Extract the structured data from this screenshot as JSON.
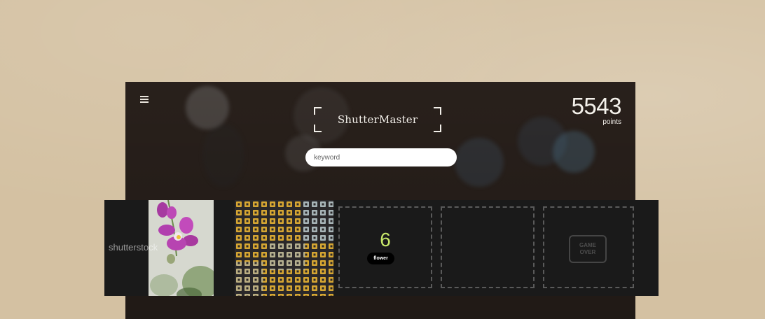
{
  "app": {
    "title": "ShutterMaster"
  },
  "search": {
    "placeholder": "keyword",
    "value": ""
  },
  "score": {
    "value": "5543",
    "label": "points"
  },
  "strip": {
    "watermark": "shutterstock",
    "counter_value": "6",
    "current_keyword": "flower",
    "game_over_line1": "GAME",
    "game_over_line2": "OVER"
  },
  "colors": {
    "background": "#d4c1a2",
    "strip": "#1a1a1a",
    "counter_accent": "#c8e86a",
    "input_bg": "#ffffff"
  },
  "icons": {
    "menu": "hamburger-menu-icon",
    "frame_corners": "viewfinder-corners-icon"
  }
}
